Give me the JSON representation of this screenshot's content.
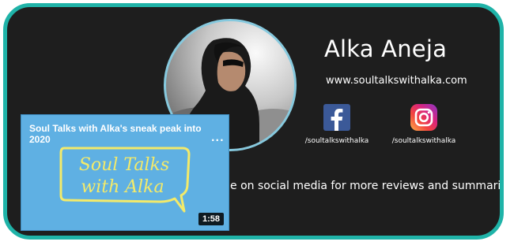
{
  "profile": {
    "name": "Alka Aneja",
    "website": "www.soultalkswithalka.com",
    "tagline_fragment": "e on social media for more reviews and summaries"
  },
  "social": [
    {
      "network": "facebook-icon",
      "handle": "/soultalkswithalka",
      "color": "#3b5998"
    },
    {
      "network": "instagram-icon",
      "handle": "/soultalkswithalka",
      "color": "#e1306c"
    }
  ],
  "video": {
    "title": "Soul Talks with Alka's sneak peak into 2020",
    "menu": "...",
    "duration": "1:58",
    "thumbnail_text_line1": "Soul Talks",
    "thumbnail_text_line2": "with Alka"
  },
  "colors": {
    "card_border": "#1fb3a8",
    "card_background": "#1e1e1e",
    "thumbnail_background": "#5fb0e3",
    "thumbnail_text": "#f3ea6a"
  }
}
